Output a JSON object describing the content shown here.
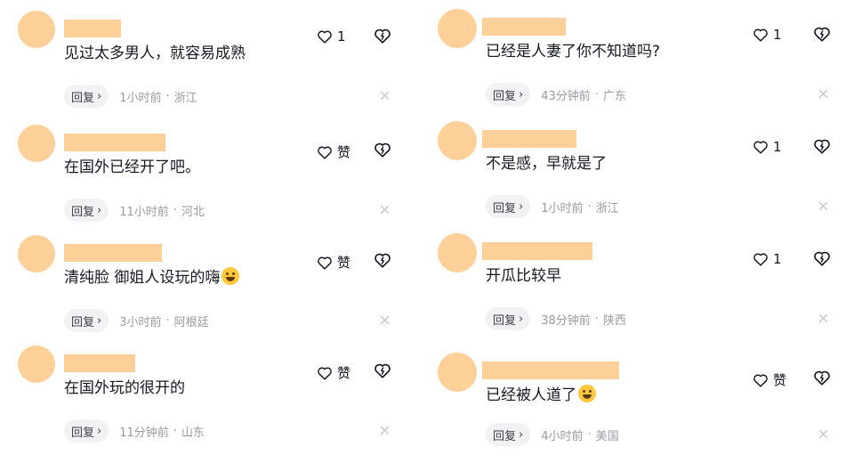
{
  "ui": {
    "reply_label": "回复",
    "reply_chevron": "›",
    "meta_separator": "·"
  },
  "columns": [
    {
      "comments": [
        {
          "text": "见过太多男人，就容易成熟",
          "emoji": "",
          "time": "1小时前",
          "location": "浙江",
          "likes": "1"
        },
        {
          "text": "在国外已经开了吧。",
          "emoji": "",
          "time": "11小时前",
          "location": "河北",
          "likes": "赞"
        },
        {
          "text": "清纯脸 御姐人设玩的嗨",
          "emoji": "smirk-emoji",
          "time": "3小时前",
          "location": "阿根廷",
          "likes": "赞"
        },
        {
          "text": "在国外玩的很开的",
          "emoji": "",
          "time": "11分钟前",
          "location": "山东",
          "likes": "赞"
        }
      ]
    },
    {
      "comments": [
        {
          "text": "已经是人妻了你不知道吗?",
          "emoji": "",
          "time": "43分钟前",
          "location": "广东",
          "likes": "1"
        },
        {
          "text": "不是感，早就是了",
          "emoji": "",
          "time": "1小时前",
          "location": "浙江",
          "likes": "1"
        },
        {
          "text": "开瓜比较早",
          "emoji": "",
          "time": "38分钟前",
          "location": "陕西",
          "likes": "1"
        },
        {
          "text": "已经被人道了",
          "emoji": "laughing-emoji",
          "time": "4小时前",
          "location": "美国",
          "likes": "赞"
        }
      ]
    }
  ],
  "icons": {
    "like": "heart-outline-icon",
    "dislike": "broken-heart-icon",
    "close": "close-x-icon"
  },
  "colors": {
    "avatar_placeholder": "#fdd09a",
    "reply_pill_bg": "#f2f2f4",
    "meta_text": "#9a9aa2",
    "primary_text": "#161823"
  }
}
